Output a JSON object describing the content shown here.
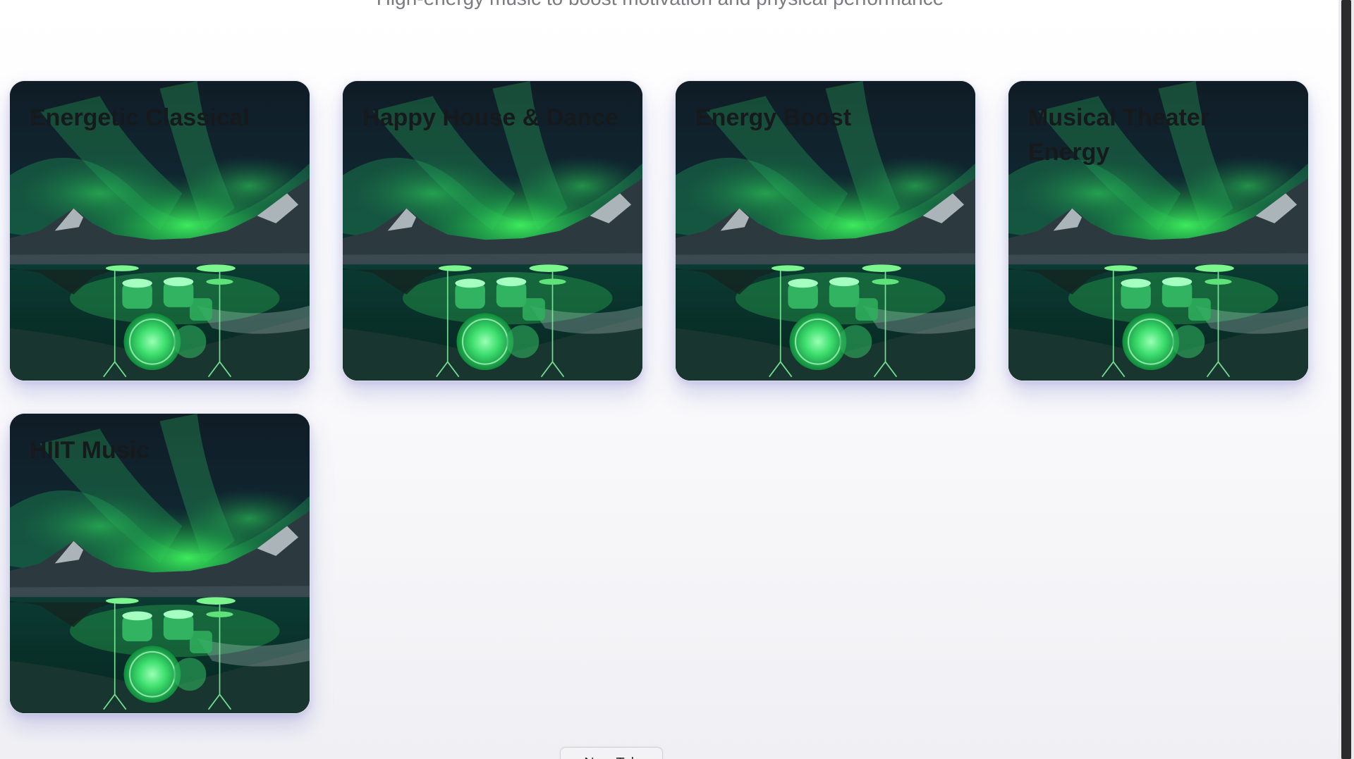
{
  "header": {
    "subtitle": "High-energy music to boost motivation and physical performance"
  },
  "playlists": [
    {
      "title": "Energetic Classical",
      "art": "aurora-drum-kit"
    },
    {
      "title": "Happy House & Dance",
      "art": "aurora-drum-kit"
    },
    {
      "title": "Energy Boost",
      "art": "aurora-drum-kit"
    },
    {
      "title": "Musical Theater Energy",
      "art": "aurora-drum-kit"
    },
    {
      "title": "HIIT Music",
      "art": "aurora-drum-kit"
    }
  ],
  "new_tab_button": {
    "label": "New Tab"
  },
  "colors": {
    "aurora_green": "#34e05a",
    "card_shadow": "#6e6ec8",
    "title_text": "#161a1c"
  }
}
